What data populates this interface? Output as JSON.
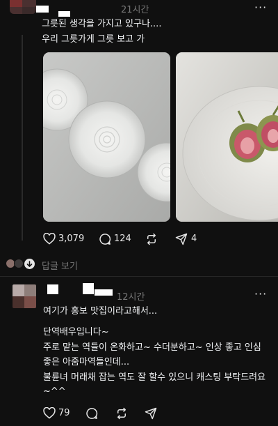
{
  "post1": {
    "time": "21시간",
    "text_lines": [
      "그릇된 생각을 가지고 있구나....",
      "우리 그릇가게 그릇 보고 가"
    ],
    "stats": {
      "likes": "3,079",
      "comments": "124"
    },
    "share_count": "4",
    "more": "···"
  },
  "replies_link": {
    "label": "답글 보기"
  },
  "post2": {
    "time": "12시간",
    "text_lines": [
      "여기가 홍보 맛집이라고해서...",
      "",
      "단역배우입니다~",
      "주로 맡는 역들이 온화하고~ 수더분하고~ 인상 좋고 인심",
      "좋은 아줌마역들인데...",
      "불륜녀 머래채 잡는 역도 잘 할수 있으니 캐스팅 부탁드려요",
      "~^^"
    ],
    "stats": {
      "likes": "79"
    },
    "more": "···"
  },
  "colors": {
    "background": "#101010",
    "text": "#f3f5f7",
    "muted": "#777777",
    "like_red": "#e0245e"
  },
  "icons": [
    "heart-icon",
    "comment-icon",
    "repost-icon",
    "share-icon",
    "more-icon",
    "arrow-down-icon"
  ]
}
